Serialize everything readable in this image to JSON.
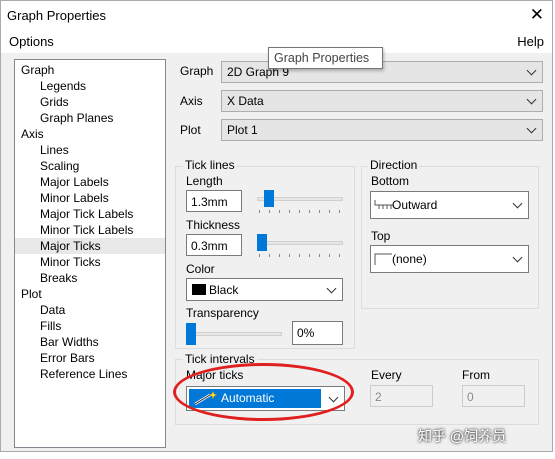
{
  "window": {
    "title": "Graph Properties",
    "close_glyph": "✕"
  },
  "menu": {
    "options": "Options",
    "help": "Help"
  },
  "tooltip": "Graph Properties",
  "tree": [
    "Graph",
    "Legends",
    "Grids",
    "Graph Planes",
    "Axis",
    "Lines",
    "Scaling",
    "Major Labels",
    "Minor Labels",
    "Major Tick Labels",
    "Minor Tick Labels",
    "Major Ticks",
    "Minor Ticks",
    "Breaks",
    "Plot",
    "Data",
    "Fills",
    "Bar Widths",
    "Error Bars",
    "Reference Lines"
  ],
  "selected_tree_item": "Major Ticks",
  "fields": {
    "graph_label": "Graph",
    "graph_value": "2D Graph 9",
    "axis_label": "Axis",
    "axis_value": "X Data",
    "plot_label": "Plot",
    "plot_value": "Plot 1"
  },
  "tick_lines": {
    "group_label": "Tick lines",
    "length_label": "Length",
    "length_value": "1.3mm",
    "length_level": 0.14,
    "thickness_label": "Thickness",
    "thickness_value": "0.3mm",
    "thickness_level": 0.05,
    "color_label": "Color",
    "color_value": "Black",
    "color_hex": "#000000",
    "transparency_label": "Transparency",
    "transparency_value": "0%",
    "transparency_level": 0.0
  },
  "direction": {
    "group_label": "Direction",
    "bottom_label": "Bottom",
    "bottom_value": "Outward",
    "top_label": "Top",
    "top_value": "(none)"
  },
  "tick_intervals": {
    "group_label": "Tick intervals",
    "major_label": "Major ticks",
    "major_value": "Automatic",
    "every_label": "Every",
    "every_value": "2",
    "from_label": "From",
    "from_value": "0"
  },
  "colors": {
    "accent": "#0078d7",
    "highlight_ring": "#e02020"
  },
  "watermark": "知乎 @饲养员"
}
